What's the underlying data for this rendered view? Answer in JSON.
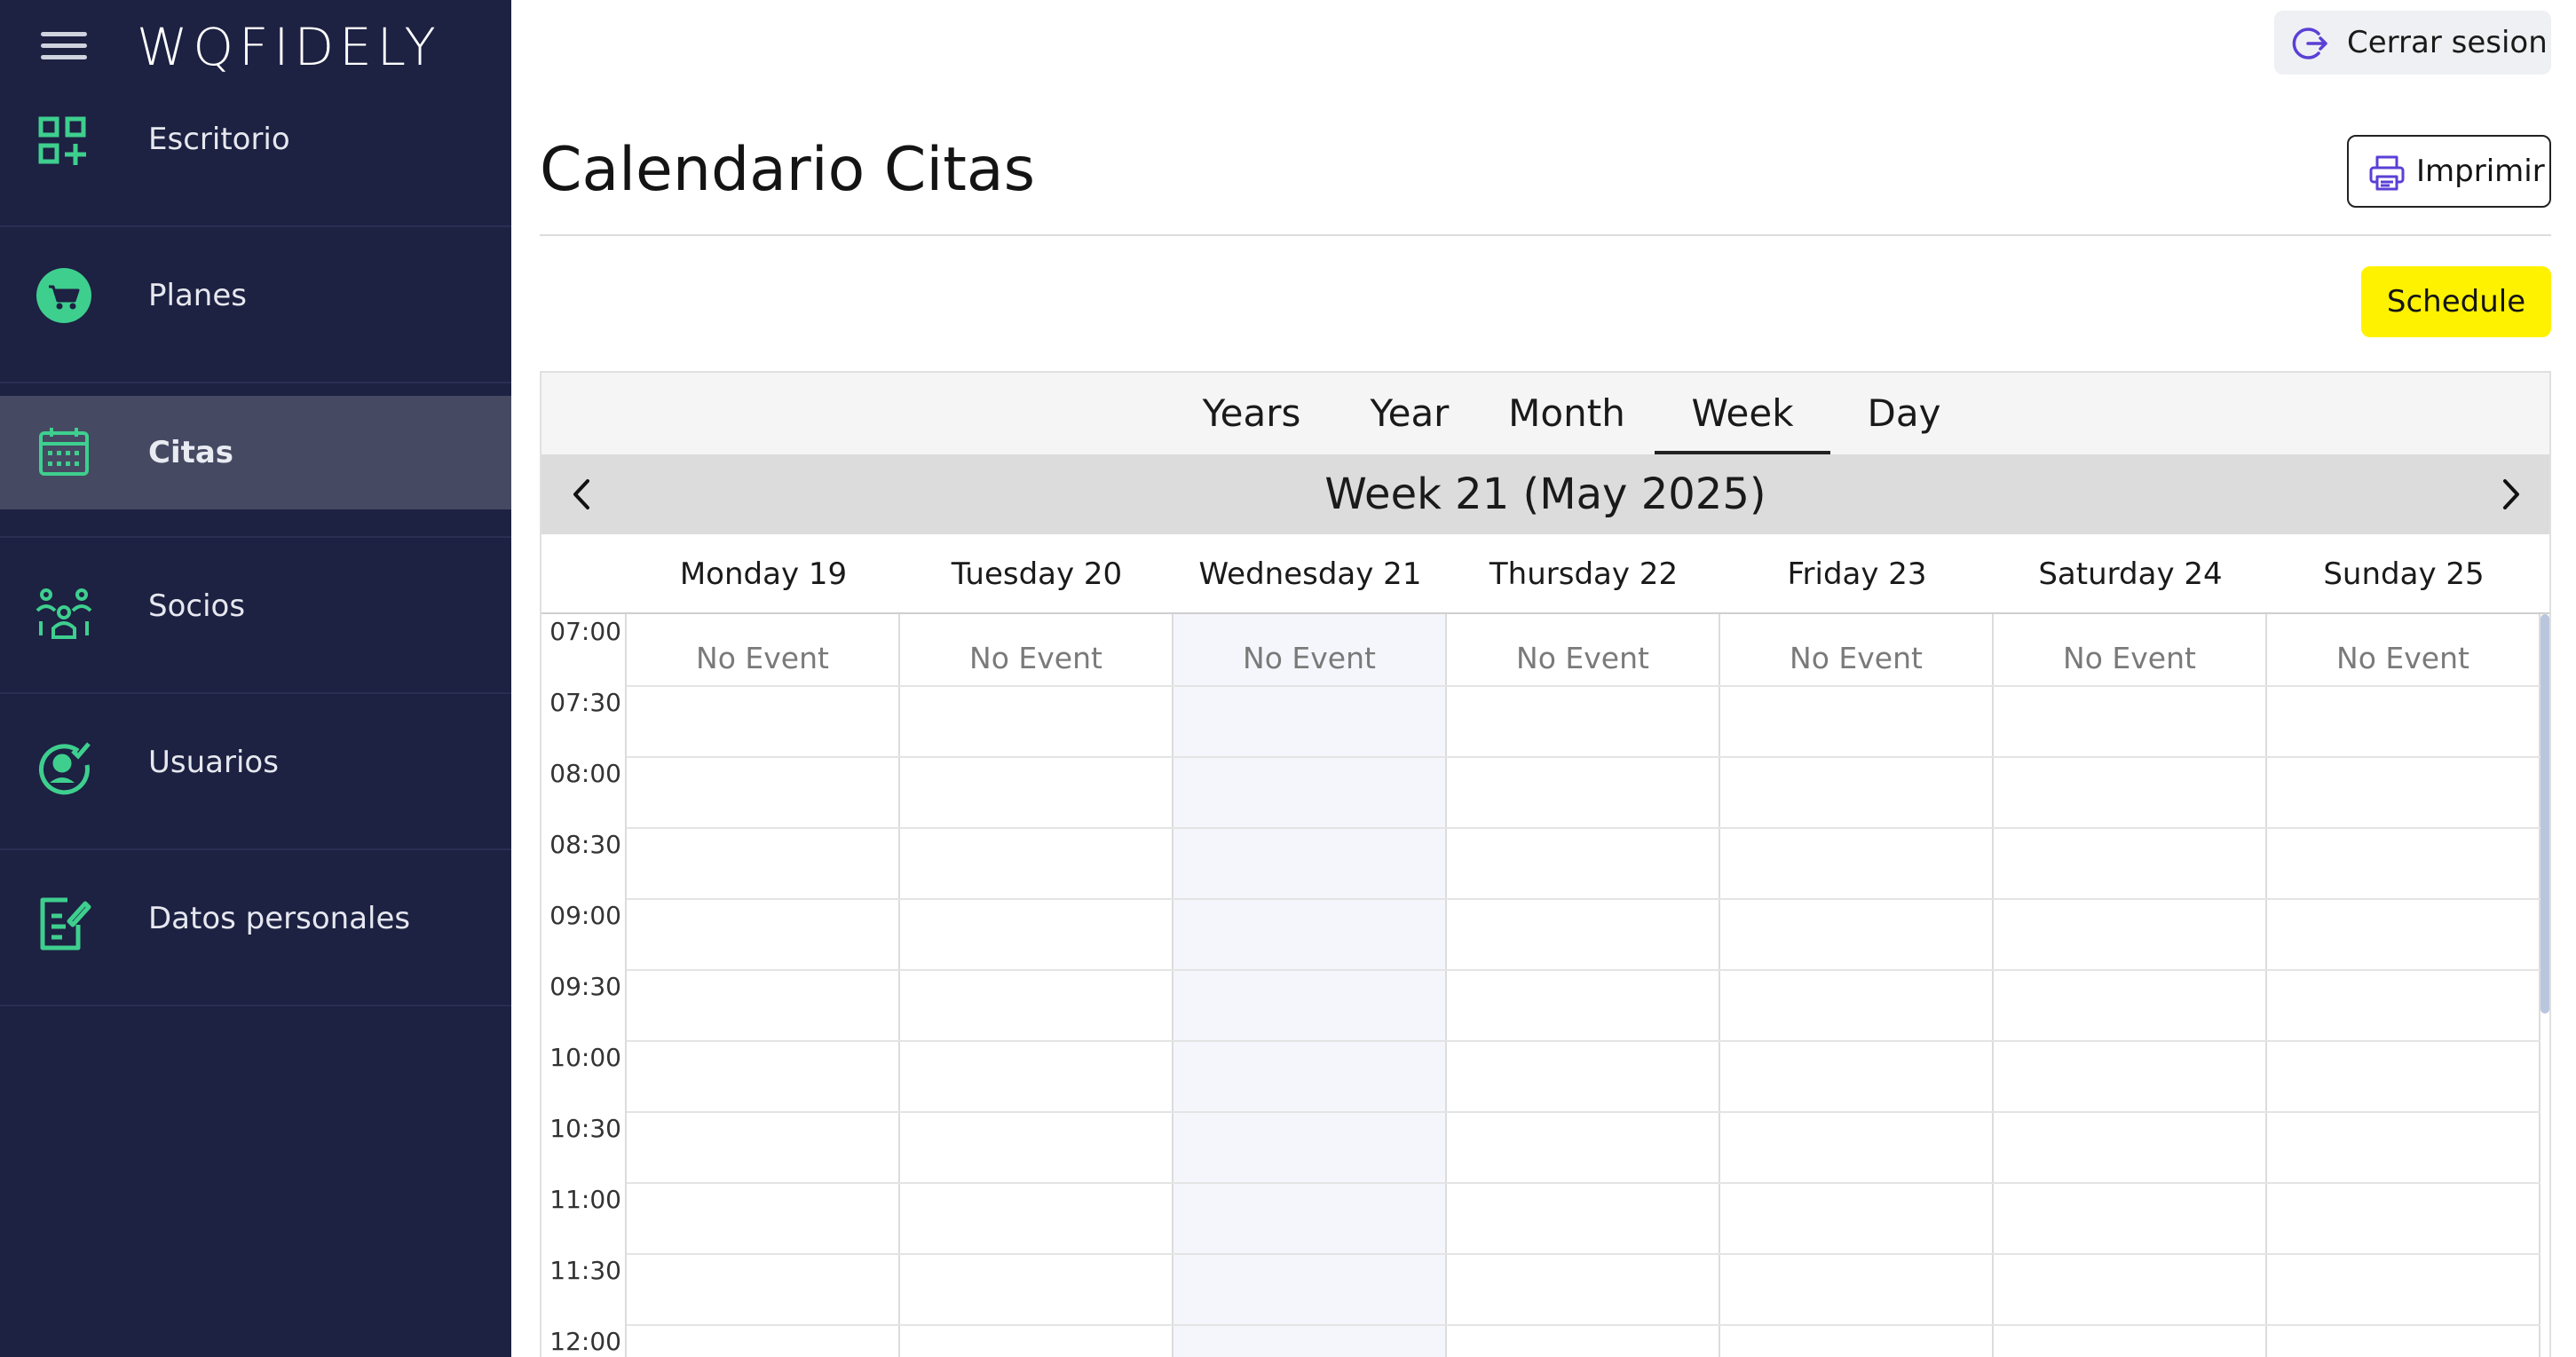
{
  "sidebar": {
    "logo": "WQFIDELY",
    "items": [
      {
        "label": "Escritorio",
        "icon": "dashboard-add-icon"
      },
      {
        "label": "Planes",
        "icon": "cart-icon"
      },
      {
        "label": "Citas",
        "icon": "calendar-icon"
      },
      {
        "label": "Socios",
        "icon": "group-icon"
      },
      {
        "label": "Usuarios",
        "icon": "user-check-icon"
      },
      {
        "label": "Datos personales",
        "icon": "edit-document-icon"
      }
    ],
    "active_item": "Citas",
    "accent_color": "#3ecf8e"
  },
  "header": {
    "logout_label": "Cerrar sesion",
    "logout_icon": "logout-icon",
    "title": "Calendario Citas",
    "print_label": "Imprimir",
    "print_icon": "printer-icon",
    "schedule_label": "Schedule",
    "schedule_color": "#fff200"
  },
  "calendar": {
    "views": [
      "Years",
      "Year",
      "Month",
      "Week",
      "Day"
    ],
    "active_view": "Week",
    "week_label": "Week 21 (May 2025)",
    "days": [
      "Monday 19",
      "Tuesday 20",
      "Wednesday 21",
      "Thursday 22",
      "Friday 23",
      "Saturday 24",
      "Sunday 25"
    ],
    "highlighted_day": "Wednesday 21",
    "empty_text": "No Event",
    "times": [
      "07:00",
      "07:30",
      "08:00",
      "08:30",
      "09:00",
      "09:30",
      "10:00",
      "10:30",
      "11:00",
      "11:30",
      "12:00"
    ]
  }
}
